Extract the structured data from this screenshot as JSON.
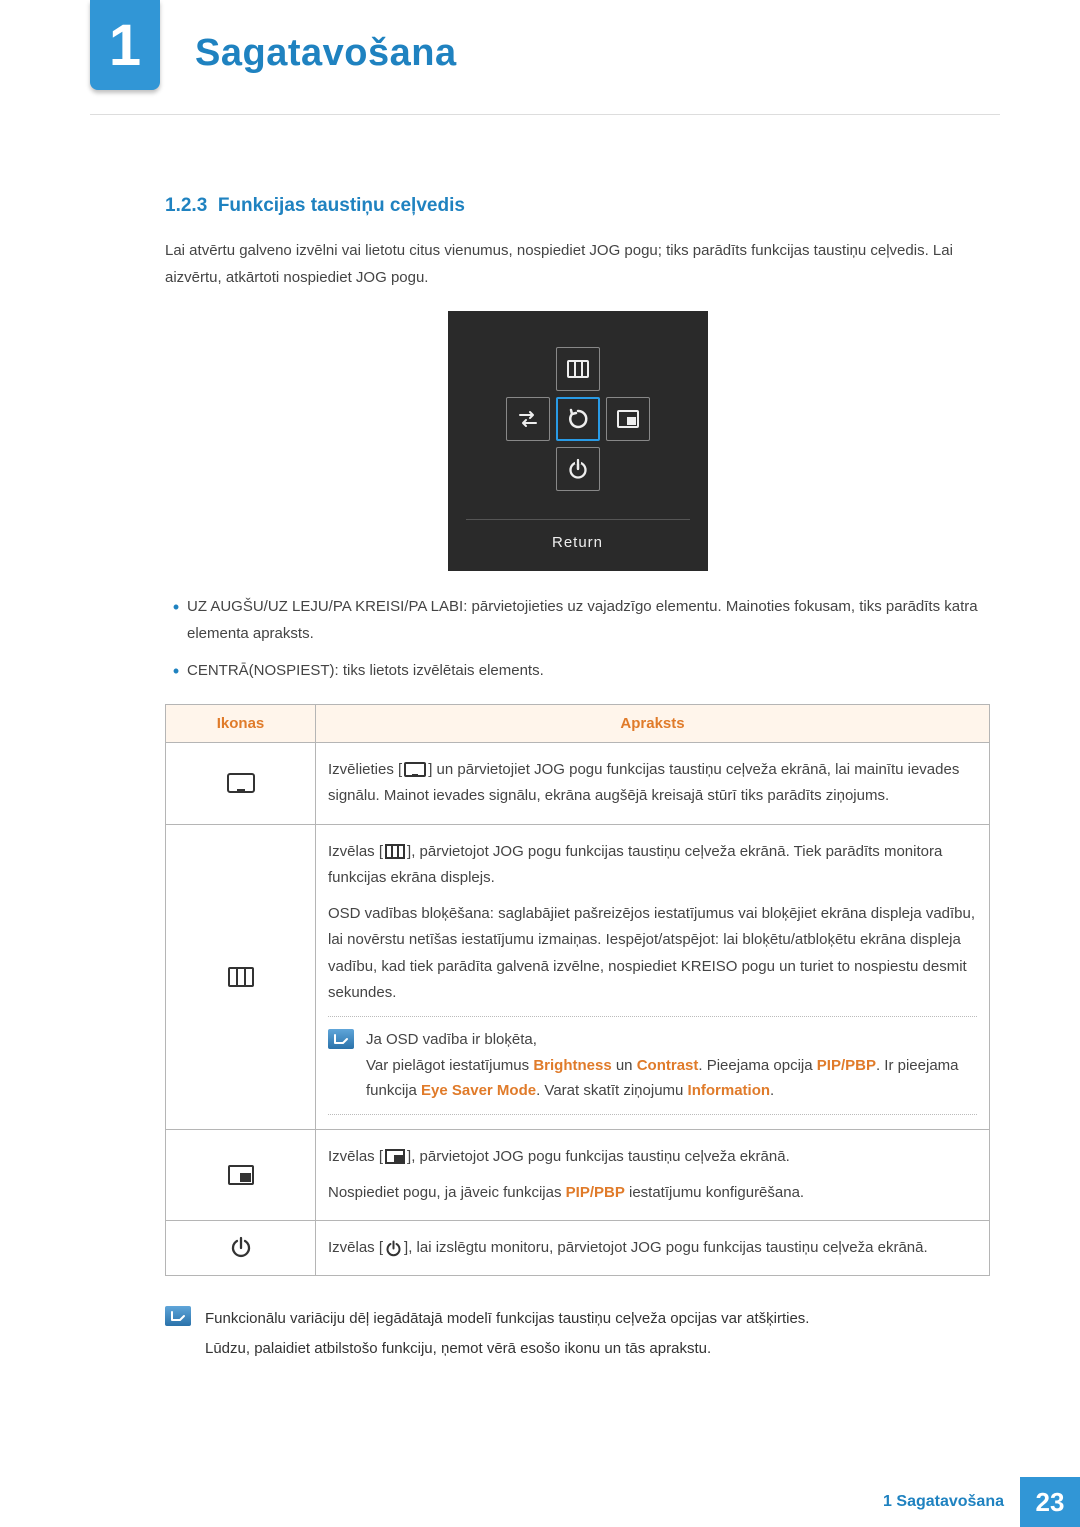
{
  "header": {
    "chapter_number": "1",
    "chapter_title": "Sagatavošana"
  },
  "section": {
    "number": "1.2.3",
    "title": "Funkcijas taustiņu ceļvedis",
    "intro": "Lai atvērtu galveno izvēlni vai lietotu citus vienumus, nospiediet JOG pogu; tiks parādīts funkcijas taustiņu ceļvedis. Lai aizvērtu, atkārtoti nospiediet JOG pogu."
  },
  "osd": {
    "return_label": "Return"
  },
  "bullets": [
    "UZ AUGŠU/UZ LEJU/PA KREISI/PA LABI: pārvietojieties uz vajadzīgo elementu. Mainoties fokusam, tiks parādīts katra elementa apraksts.",
    "CENTRĀ(NOSPIEST): tiks lietots izvēlētais elements."
  ],
  "table": {
    "head_icons": "Ikonas",
    "head_desc": "Apraksts",
    "rows": {
      "source": {
        "p1a": "Izvēlieties [",
        "p1b": "] un pārvietojiet JOG pogu funkcijas taustiņu ceļveža ekrānā, lai mainītu ievades signālu. Mainot ievades signālu, ekrāna augšējā kreisajā stūrī tiks parādīts ziņojums."
      },
      "menu": {
        "p1a": "Izvēlas [",
        "p1b": "], pārvietojot JOG pogu funkcijas taustiņu ceļveža ekrānā. Tiek parādīts monitora funkcijas ekrāna displejs.",
        "p2": "OSD vadības bloķēšana: saglabājiet pašreizējos iestatījumus vai bloķējiet ekrāna displeja vadību, lai novērstu netīšas iestatījumu izmaiņas. Iespējot/atspējot: lai bloķētu/atbloķētu ekrāna displeja vadību, kad tiek parādīta galvenā izvēlne, nospiediet KREISO pogu un turiet to nospiestu desmit sekundes.",
        "note_lead": "Ja OSD vadība ir bloķēta,",
        "note_body_1": "Var pielāgot iestatījumus ",
        "kw_brightness": "Brightness",
        "note_body_2": " un ",
        "kw_contrast": "Contrast",
        "note_body_3": ". Pieejama opcija ",
        "kw_pipbp": "PIP/PBP",
        "note_body_4": ". Ir pieejama funkcija ",
        "kw_eye": "Eye Saver Mode",
        "note_body_5": ". Varat skatīt ziņojumu ",
        "kw_info": "Information",
        "note_body_6": "."
      },
      "pip": {
        "p1a": "Izvēlas [",
        "p1b": "], pārvietojot JOG pogu funkcijas taustiņu ceļveža ekrānā.",
        "p2a": "Nospiediet pogu, ja jāveic funkcijas ",
        "kw_pipbp": "PIP/PBP",
        "p2b": " iestatījumu konfigurēšana."
      },
      "power": {
        "p1a": "Izvēlas [",
        "p1b": "], lai izslēgtu monitoru, pārvietojot JOG pogu funkcijas taustiņu ceļveža ekrānā."
      }
    }
  },
  "footer_note": {
    "l1": "Funkcionālu variāciju dēļ iegādātajā modelī funkcijas taustiņu ceļveža opcijas var atšķirties.",
    "l2": "Lūdzu, palaidiet atbilstošo funkciju, ņemot vērā esošo ikonu un tās aprakstu."
  },
  "page_footer": {
    "chapter_label": "1 Sagatavošana",
    "page_number": "23"
  }
}
